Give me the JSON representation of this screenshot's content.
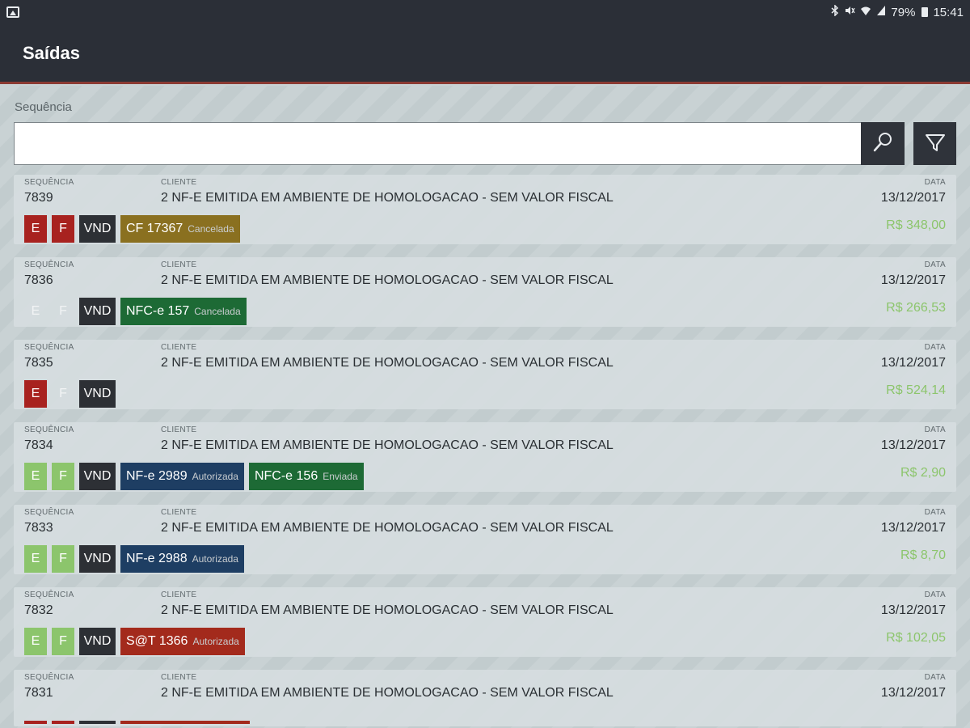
{
  "status_bar": {
    "battery": "79%",
    "time": "15:41"
  },
  "app_bar": {
    "title": "Saídas"
  },
  "search": {
    "label": "Sequência",
    "value": "",
    "placeholder": ""
  },
  "columns": {
    "seq": "SEQUÊNCIA",
    "client": "CLIENTE",
    "date": "DATA"
  },
  "rows": [
    {
      "seq": "7839",
      "client": "2 NF-E EMITIDA EM AMBIENTE DE HOMOLOGACAO - SEM VALOR FISCAL",
      "date": "13/12/2017",
      "total": "R$ 348,00",
      "e": "E",
      "f": "F",
      "type": "VND",
      "docs": [
        {
          "name": "CF 17367",
          "status": "Cancelada",
          "color": "#8a7020"
        }
      ]
    },
    {
      "seq": "7836",
      "client": "2 NF-E EMITIDA EM AMBIENTE DE HOMOLOGACAO - SEM VALOR FISCAL",
      "date": "13/12/2017",
      "total": "R$ 266,53",
      "e": "E",
      "f": "F",
      "type": "VND",
      "docs": [
        {
          "name": "NFC-e 157",
          "status": "Cancelada",
          "color": "#1d6a35"
        }
      ]
    },
    {
      "seq": "7835",
      "client": "2 NF-E EMITIDA EM AMBIENTE DE HOMOLOGACAO - SEM VALOR FISCAL",
      "date": "13/12/2017",
      "total": "R$ 524,14",
      "e": "E",
      "f": "F",
      "type": "VND",
      "docs": []
    },
    {
      "seq": "7834",
      "client": "2 NF-E EMITIDA EM AMBIENTE DE HOMOLOGACAO - SEM VALOR FISCAL",
      "date": "13/12/2017",
      "total": "R$ 2,90",
      "e": "E",
      "f": "F",
      "type": "VND",
      "docs": [
        {
          "name": "NF-e 2989",
          "status": "Autorizada",
          "color": "#1e3e63"
        },
        {
          "name": "NFC-e 156",
          "status": "Enviada",
          "color": "#1d6a35"
        }
      ]
    },
    {
      "seq": "7833",
      "client": "2 NF-E EMITIDA EM AMBIENTE DE HOMOLOGACAO - SEM VALOR FISCAL",
      "date": "13/12/2017",
      "total": "R$ 8,70",
      "e": "E",
      "f": "F",
      "type": "VND",
      "docs": [
        {
          "name": "NF-e 2988",
          "status": "Autorizada",
          "color": "#1e3e63"
        }
      ]
    },
    {
      "seq": "7832",
      "client": "2 NF-E EMITIDA EM AMBIENTE DE HOMOLOGACAO - SEM VALOR FISCAL",
      "date": "13/12/2017",
      "total": "R$ 102,05",
      "e": "E",
      "f": "F",
      "type": "VND",
      "docs": [
        {
          "name": "S@T 1366",
          "status": "Autorizada",
          "color": "#a32a1c"
        }
      ]
    },
    {
      "seq": "7831",
      "client": "2 NF-E EMITIDA EM AMBIENTE DE HOMOLOGACAO - SEM VALOR FISCAL",
      "date": "13/12/2017"
    }
  ],
  "colors": {
    "header": "#2b2f37",
    "accent_line": "#8b3a33",
    "red": "#a8221f",
    "green": "#8cc56c",
    "dark": "#2d3035"
  },
  "icons": {
    "search": "search-icon",
    "filter": "filter-icon"
  }
}
